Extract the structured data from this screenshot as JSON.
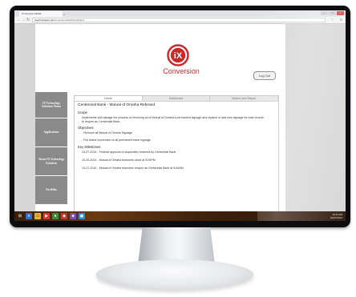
{
  "browser": {
    "tab_title": "Conversion Mobile",
    "url_host": "ixtechnologies.net",
    "url_path": "/conversion/dashboard/index"
  },
  "header": {
    "logo_mark": "iX",
    "logo_text": "Conversion",
    "logout_label": "Log Out"
  },
  "sidebar": {
    "items": [
      {
        "label": "IX Technology Solutions Home"
      },
      {
        "label": "Applications"
      },
      {
        "label": "About IX Technology Solutions"
      },
      {
        "label": "Portfolio"
      }
    ]
  },
  "tabs": [
    {
      "label": "Home",
      "active": true
    },
    {
      "label": "Dashboard",
      "active": false
    },
    {
      "label": "Search and Report",
      "active": false
    }
  ],
  "project": {
    "title": "Centennial Bank - Mutual of Omaha Rebrand",
    "scope_heading": "Scope",
    "scope_text": "Implements will manage the process of removing all of Mutual of Omaha's permanent signage and replace or add new signage for each branch to reopen as Centennial Bank.",
    "objectives_heading": "Objectives",
    "objectives": [
      "- Remove all Mutual of Omaha Signage",
      "- Full brand conversion of all permanent bank signage"
    ],
    "milestones_heading": "Key Milestones",
    "milestones": [
      "10-07-2014 - Federal approval of acquisition received by Centennial Bank",
      "10-25-2014 - Mutual of Omaha branches close at 5:00PM",
      "10-27-2014 - Mutual of Omaha branches reopen as Centennial Bank at 9:00AM"
    ]
  },
  "taskbar": {
    "time": "10:24 AM",
    "date": "10/27/2014"
  },
  "colors": {
    "brand_red": "#cc2a2a",
    "sidebar_gray": "#8a8a8a",
    "bezel": "#0d0d0f"
  }
}
